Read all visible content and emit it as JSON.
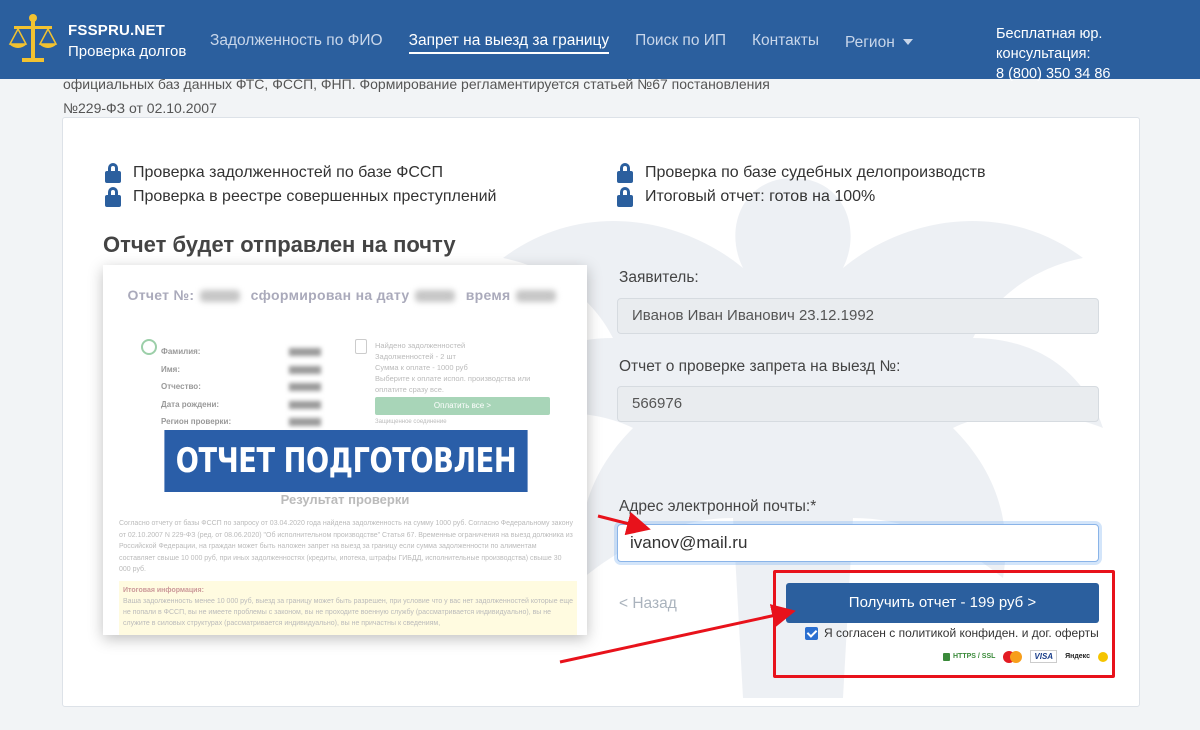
{
  "navbar": {
    "brand_name": "FSSPRU.NET",
    "brand_sub": "Проверка долгов",
    "links": [
      {
        "label": "Задолженность по ФИО"
      },
      {
        "label": "Запрет на выезд за границу"
      },
      {
        "label": "Поиск по ИП"
      },
      {
        "label": "Контакты"
      },
      {
        "label": "Регион"
      }
    ],
    "consult_label": "Бесплатная юр. консультация:",
    "consult_phone": "8 (800) 350 34 86"
  },
  "intro": {
    "line1": "официальных баз данных ФТС, ФССП, ФНП. Формирование регламентируется статьей №67 постановления",
    "line2": "№229-ФЗ от 02.10.2007"
  },
  "checks_left": [
    "Проверка задолженностей по базе ФССП",
    "Проверка в реестре совершенных преступлений"
  ],
  "checks_right": [
    "Проверка по базе судебных делопроизводств",
    "Итоговый отчет: готов на 100%"
  ],
  "report_title": "Отчет будет отправлен на почту",
  "preview": {
    "head_part1": "Отчет №:",
    "head_part2": "сформирован на дату",
    "head_part3": "время",
    "fields": [
      "Фамилия:",
      "Имя:",
      "Отчество:",
      "Дата рождени:",
      "Регион проверки:"
    ],
    "right_lines": [
      "Найдено задолженностей",
      "Задолженностей - 2 шт",
      "Сумма к оплате - 1000 руб",
      "Выберите к оплате испол. производства или",
      "оплатите сразу все."
    ],
    "pay_button": "Оплатить все >",
    "pay_small": "Защищенное соединение",
    "banner": "ОТЧЕТ ПОДГОТОВЛЕН",
    "result": "Результат проверки",
    "paragraph": "Согласно отчету от базы ФССП по запросу от 03.04.2020 года найдена задолженность на сумму 1000 руб. Согласно Федеральному закону от 02.10.2007 N 229-ФЗ (ред. от 08.06.2020) \"Об исполнительном производстве\" Статья 67. Временные ограничения на выезд должника из Российской Федерации, на граждан может быть наложен запрет на выезд за границу если сумма задолженности по алиментам составляет свыше 10 000 руб, при иных задолженностях (кредиты, ипотека, штрафы ГИБДД, исполнительные производства) свыше 30 000 руб.",
    "yellow_title": "Итоговая информация:",
    "yellow_text": "Ваша задолженность менее 10 000 руб, выезд за границу может быть разрешен, при условие что у вас нет задолженностей которые еще не попали в ФССП, вы не имеете проблемы с законом, вы не проходите военную службу (рассматривается индивидуально), вы не служите в силовых структурах (рассматривается индивидуально), вы не причастны к сведениям,"
  },
  "form": {
    "applicant_label": "Заявитель:",
    "applicant_value": "Иванов Иван Иванович 23.12.1992",
    "report_label": "Отчет о проверке запрета на выезд №:",
    "report_value": "566976",
    "email_label": "Адрес электронной почты:*",
    "email_value": "ivanov@mail.ru",
    "back_label": "< Назад",
    "submit_label": "Получить отчет - 199 руб >",
    "agree_label": "Я согласен с политикой конфиден. и дог. оферты",
    "agree_checked": true,
    "https_label": "HTTPS / SSL",
    "visa_label": "VISA",
    "yandex_label": "Яндекс"
  },
  "colors": {
    "navbar": "#2b5f9e",
    "button": "#2b5f9e",
    "banner": "#2a5ea8",
    "annotation_red": "#e8121b"
  }
}
